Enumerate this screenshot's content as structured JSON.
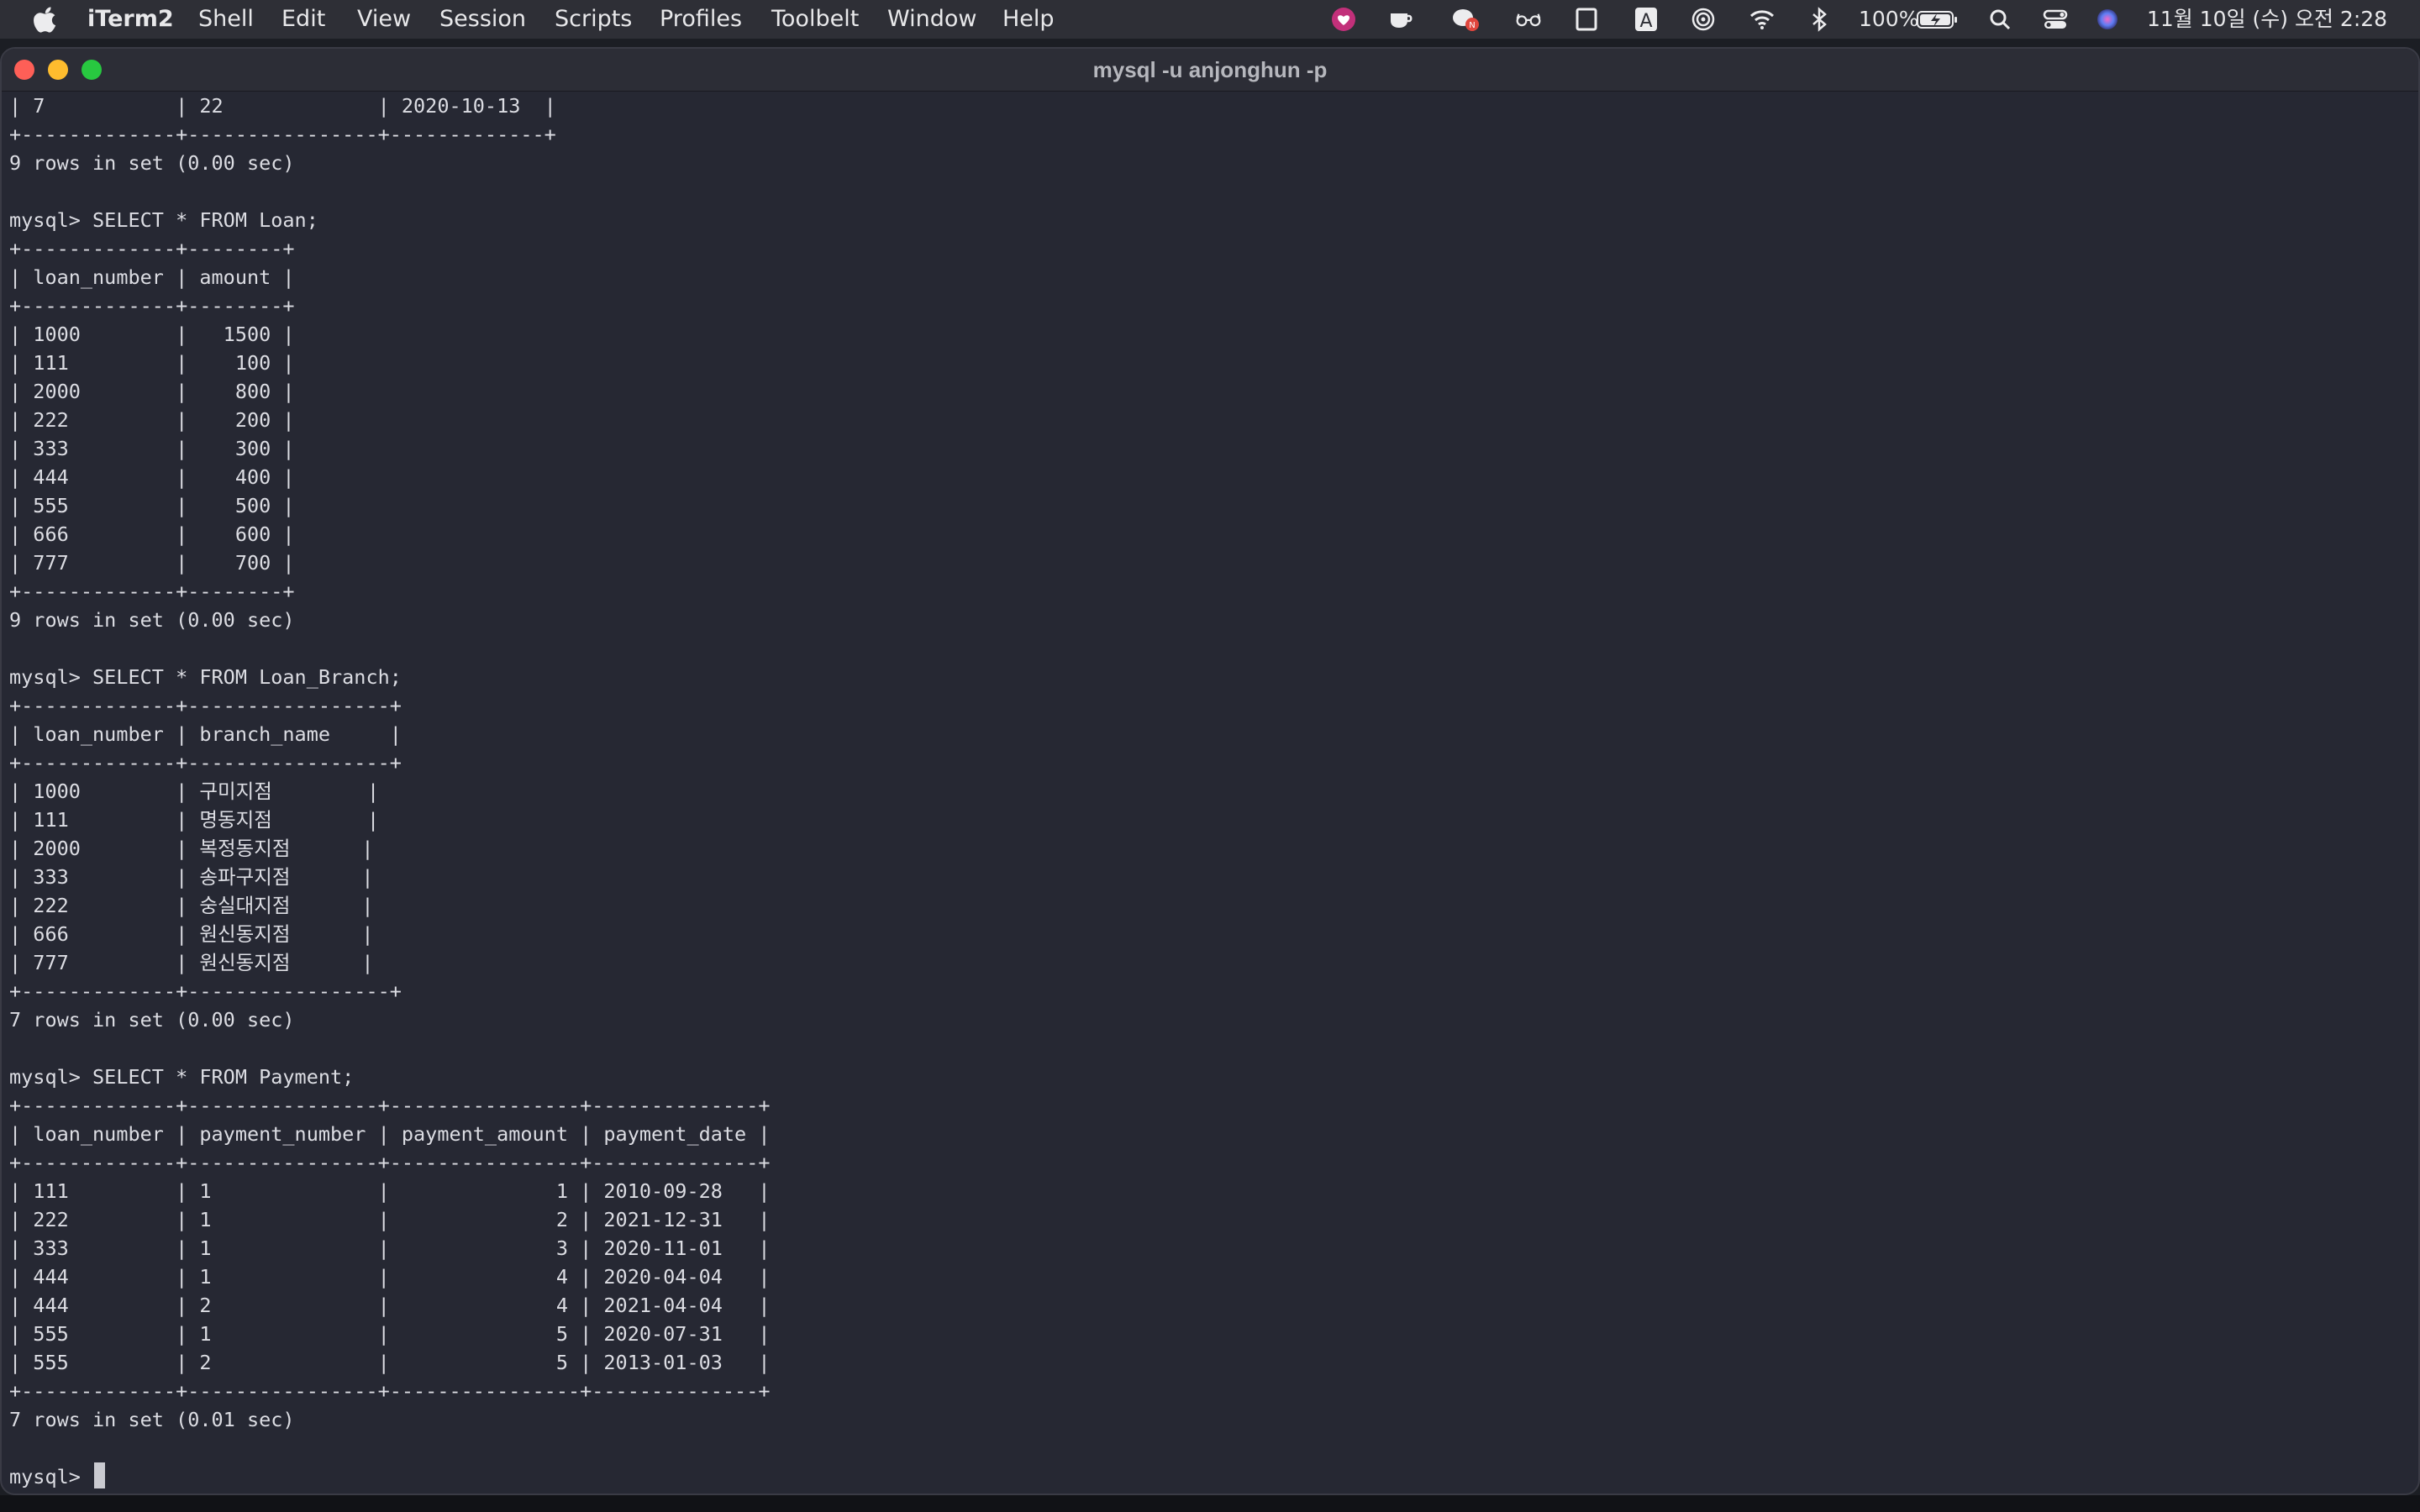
{
  "menubar": {
    "app_name": "iTerm2",
    "menus": [
      "Shell",
      "Edit",
      "View",
      "Session",
      "Scripts",
      "Profiles",
      "Toolbelt",
      "Window",
      "Help"
    ],
    "battery": "100%",
    "datetime": "11월 10일 (수) 오전 2:28",
    "tray_icons": [
      "heart-monitor-icon",
      "coffee-cup-icon",
      "chat-notification-icon",
      "glasses-icon",
      "square-window-icon",
      "input-source-a-icon",
      "airdrop-icon",
      "wifi-icon",
      "bluetooth-icon",
      "battery-icon",
      "search-icon",
      "control-center-icon",
      "siri-icon"
    ]
  },
  "window": {
    "title": "mysql -u anjonghun -p"
  },
  "terminal": {
    "lines": [
      "| 7           | 22             | 2020-10-13  |",
      "+-------------+----------------+-------------+",
      "9 rows in set (0.00 sec)",
      "",
      "mysql> SELECT * FROM Loan;",
      "+-------------+--------+",
      "| loan_number | amount |",
      "+-------------+--------+",
      "| 1000        |   1500 |",
      "| 111         |    100 |",
      "| 2000        |    800 |",
      "| 222         |    200 |",
      "| 333         |    300 |",
      "| 444         |    400 |",
      "| 555         |    500 |",
      "| 666         |    600 |",
      "| 777         |    700 |",
      "+-------------+--------+",
      "9 rows in set (0.00 sec)",
      "",
      "mysql> SELECT * FROM Loan_Branch;",
      "+-------------+-----------------+",
      "| loan_number | branch_name     |",
      "+-------------+-----------------+",
      "| 1000        | 구미지점        |",
      "| 111         | 명동지점        |",
      "| 2000        | 복정동지점      |",
      "| 333         | 송파구지점      |",
      "| 222         | 숭실대지점      |",
      "| 666         | 원신동지점      |",
      "| 777         | 원신동지점      |",
      "+-------------+-----------------+",
      "7 rows in set (0.00 sec)",
      "",
      "mysql> SELECT * FROM Payment;",
      "+-------------+----------------+----------------+--------------+",
      "| loan_number | payment_number | payment_amount | payment_date |",
      "+-------------+----------------+----------------+--------------+",
      "| 111         | 1              |              1 | 2010-09-28   |",
      "| 222         | 1              |              2 | 2021-12-31   |",
      "| 333         | 1              |              3 | 2020-11-01   |",
      "| 444         | 1              |              4 | 2020-04-04   |",
      "| 444         | 2              |              4 | 2021-04-04   |",
      "| 555         | 1              |              5 | 2020-07-31   |",
      "| 555         | 2              |              5 | 2013-01-03   |",
      "+-------------+----------------+----------------+--------------+",
      "7 rows in set (0.01 sec)",
      ""
    ],
    "prompt": "mysql> "
  }
}
